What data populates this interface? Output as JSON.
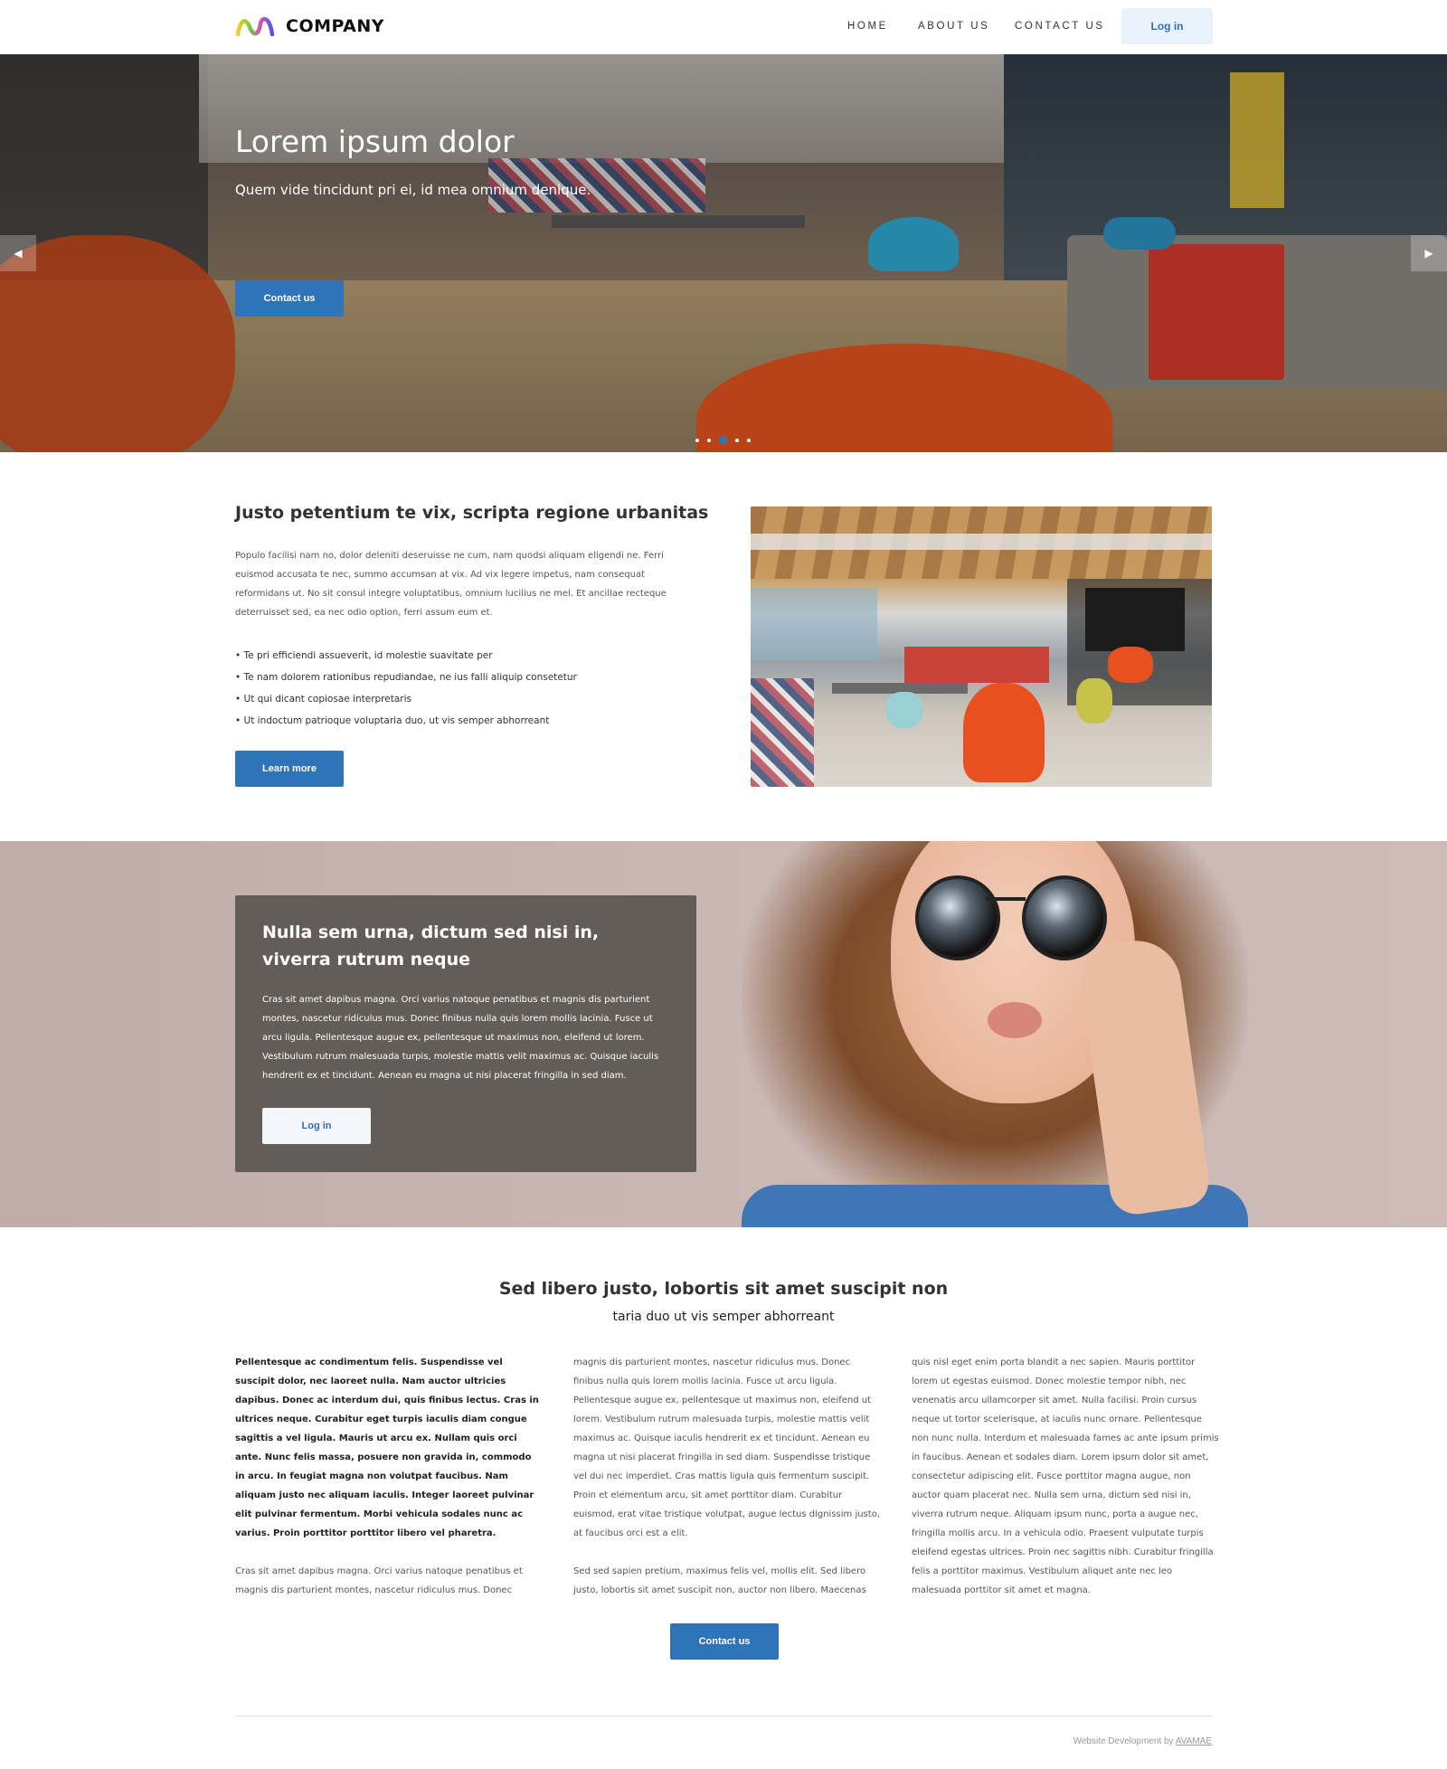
{
  "header": {
    "brand": "COMPANY",
    "nav": [
      {
        "label": "HOME"
      },
      {
        "label": "ABOUT US"
      },
      {
        "label": "CONTACT US"
      }
    ],
    "login_label": "Log in"
  },
  "hero": {
    "title": "Lorem ipsum dolor",
    "subtitle": "Quem vide tincidunt pri ei, id mea omnium denique.",
    "button_label": "Contact us",
    "prev_icon": "◀",
    "next_icon": "▶",
    "slides_total": 5,
    "active_slide": 3
  },
  "intro": {
    "title": "Justo petentium te vix, scripta regione urbanitas",
    "paragraph": "Populo facilisi nam no, dolor deleniti deseruisse ne cum, nam quodsi aliquam eligendi ne. Ferri euismod accusata te nec, summo accumsan at vix. Ad vix legere impetus, nam consequat reformidans ut. No sit consul integre voluptatibus, omnium lucilius ne mel. Et ancillae recteque deterruisset sed, ea nec odio option, ferri assum eum et.",
    "bullets": [
      "• Te pri efficiendi assueverit, id molestie suavitate per",
      "• Te nam dolorem rationibus repudiandae, ne ius falli aliquip consetetur",
      "• Ut qui dicant copiosae interpretaris",
      "• Ut indoctum patrioque voluptaria duo, ut vis semper abhorreant"
    ],
    "button_label": "Learn more"
  },
  "feature": {
    "title": "Nulla sem urna, dictum sed nisi in, viverra rutrum neque",
    "paragraph": "Cras sit amet dapibus magna. Orci varius natoque penatibus et magnis dis parturient montes, nascetur ridiculus mus. Donec finibus nulla quis lorem mollis lacinia. Fusce ut arcu ligula. Pellentesque augue ex, pellentesque ut maximus non, eleifend ut lorem. Vestibulum rutrum malesuada turpis, molestie mattis velit maximus ac. Quisque iaculis hendrerit ex et tincidunt. Aenean eu magna ut nisi placerat fringilla in sed diam.",
    "button_label": "Log in"
  },
  "columns_section": {
    "title": "Sed libero justo, lobortis sit amet suscipit non",
    "subtitle": "taria duo ut vis semper abhorreant",
    "col1_bold": "Pellentesque ac condimentum felis. Suspendisse vel suscipit dolor, nec laoreet nulla. Nam auctor ultricies dapibus. Donec ac interdum dui, quis finibus lectus. Cras in ultrices neque. Curabitur eget turpis iaculis diam congue sagittis a vel ligula. Mauris ut arcu ex. Nullam quis orci ante. Nunc felis massa, posuere non gravida in, commodo in arcu. In feugiat magna non volutpat faucibus. Nam aliquam justo nec aliquam iaculis. Integer laoreet pulvinar elit pulvinar fermentum. Morbi vehicula sodales nunc ac varius. Proin porttitor porttitor libero vel pharetra.",
    "col1_text": "Cras sit amet dapibus magna. Orci varius natoque penatibus et magnis dis parturient montes, nascetur ridiculus mus. Donec",
    "col2_text1": "magnis dis parturient montes, nascetur ridiculus mus. Donec finibus nulla quis lorem mollis lacinia. Fusce ut arcu ligula. Pellentesque augue ex, pellentesque ut maximus non, eleifend ut lorem. Vestibulum rutrum malesuada turpis, molestie mattis velit maximus ac. Quisque iaculis hendrerit ex et tincidunt. Aenean eu magna ut nisi placerat fringilla in sed diam. Suspendisse tristique vel dui nec imperdiet. Cras mattis ligula quis fermentum suscipit. Proin et elementum arcu, sit amet porttitor diam. Curabitur euismod, erat vitae tristique volutpat, augue lectus dignissim justo, at faucibus orci est a elit.",
    "col2_text2": "Sed sed sapien pretium, maximus felis vel, mollis elit. Sed libero justo, lobortis sit amet suscipit non, auctor non libero. Maecenas",
    "col3_text": "quis nisl eget enim porta blandit a nec sapien. Mauris porttitor lorem ut egestas euismod. Donec molestie tempor nibh, nec venenatis arcu ullamcorper sit amet. Nulla facilisi. Proin cursus neque ut tortor scelerisque, at iaculis nunc ornare. Pellentesque non nunc nulla. Interdum et malesuada fames ac ante ipsum primis in faucibus. Aenean et sodales diam. Lorem ipsum dolor sit amet, consectetur adipiscing elit. Fusce porttitor magna augue, non auctor quam placerat nec. Nulla sem urna, dictum sed nisi in, viverra rutrum neque. Aliquam ipsum nunc, porta a augue nec, fringilla mollis arcu. In a vehicula odio. Praesent vulputate turpis eleifend egestas ultrices. Proin nec sagittis nibh. Curabitur fringilla felis a porttitor maximus. Vestibulum aliquet ante nec leo malesuada porttitor sit amet et magna.",
    "button_label": "Contact us"
  },
  "footer": {
    "credit_prefix": "Website Development by",
    "credit_link": "AVAMAE"
  },
  "colors": {
    "primary": "#2f74b9",
    "login_bg": "#eaf3fc",
    "card_bg": "#645c58"
  }
}
